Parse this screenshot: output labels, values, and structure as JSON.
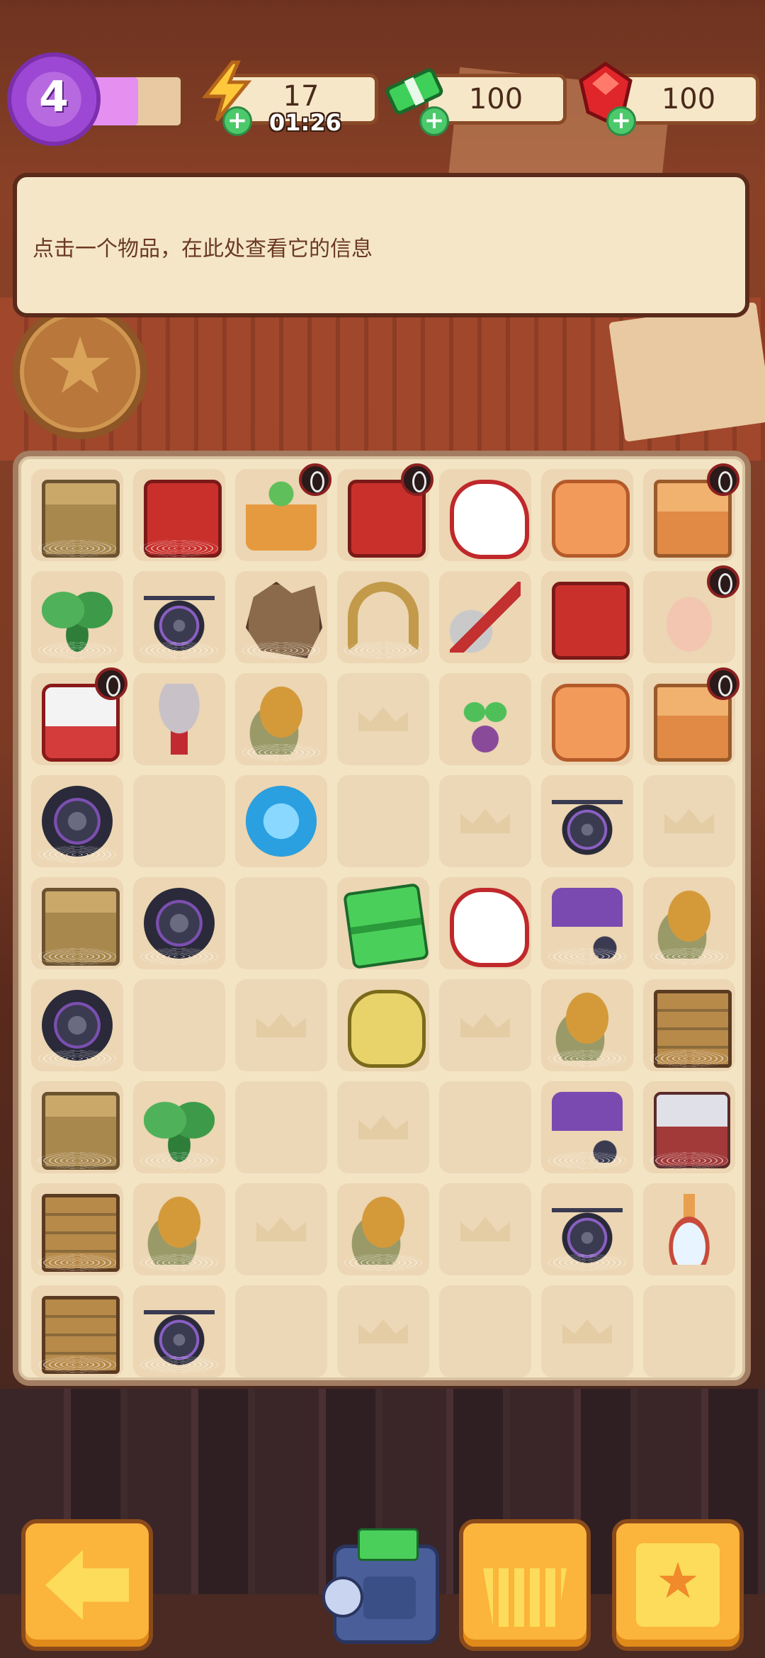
{
  "hud": {
    "level": "4",
    "xp_fraction": 0.6,
    "energy": "17",
    "energy_timer": "01:26",
    "cash": "100",
    "gems": "100",
    "plus_symbol": "+"
  },
  "info_panel": {
    "message": "点击一个物品，在此处查看它的信息"
  },
  "board": {
    "columns": 7,
    "rows": 9,
    "cells": [
      [
        "box",
        "toolbox",
        "plant-pot",
        "red-toolbox-open",
        "glove",
        "cushions",
        "open-box"
      ],
      [
        "leaf-plant",
        "bicycle",
        "scrap",
        "horseshoe",
        "trowel",
        "red-toolbox",
        "vase"
      ],
      [
        "robot-toolbox",
        "mushroom",
        "hat",
        "locked",
        "sprout",
        "cushion",
        "open-box-vases"
      ],
      [
        "wheels",
        "empty",
        "energy",
        "empty",
        "locked",
        "bicycle",
        "locked"
      ],
      [
        "box-open",
        "wheels",
        "empty",
        "cash",
        "glove",
        "moped",
        "hat"
      ],
      [
        "wheels",
        "empty",
        "locked",
        "seed-bag",
        "locked",
        "hat",
        "crate"
      ],
      [
        "box",
        "leaf-plant",
        "empty",
        "locked",
        "empty",
        "moped",
        "drill"
      ],
      [
        "crate",
        "hat",
        "locked",
        "hat",
        "locked",
        "bicycle",
        "decanter"
      ],
      [
        "crate",
        "bicycle",
        "empty",
        "locked",
        "empty",
        "locked",
        "empty"
      ]
    ],
    "badged": [
      [
        0,
        2
      ],
      [
        0,
        3
      ],
      [
        0,
        6
      ],
      [
        1,
        6
      ],
      [
        2,
        0
      ],
      [
        2,
        6
      ]
    ],
    "webbed": [
      [
        0,
        0
      ],
      [
        0,
        1
      ],
      [
        1,
        0
      ],
      [
        1,
        1
      ],
      [
        1,
        2
      ],
      [
        1,
        3
      ],
      [
        2,
        2
      ],
      [
        3,
        0
      ],
      [
        4,
        0
      ],
      [
        4,
        1
      ],
      [
        4,
        5
      ],
      [
        4,
        6
      ],
      [
        5,
        0
      ],
      [
        5,
        5
      ],
      [
        5,
        6
      ],
      [
        6,
        0
      ],
      [
        6,
        1
      ],
      [
        6,
        5
      ],
      [
        6,
        6
      ],
      [
        7,
        0
      ],
      [
        7,
        1
      ],
      [
        7,
        3
      ],
      [
        7,
        5
      ],
      [
        8,
        0
      ],
      [
        8,
        1
      ]
    ]
  },
  "bottom_bar": {
    "back_icon": "arrow-left-icon",
    "safe_icon": "cash-safe-icon",
    "shop_icon": "basket-icon",
    "tasks_icon": "clipboard-star-icon"
  }
}
